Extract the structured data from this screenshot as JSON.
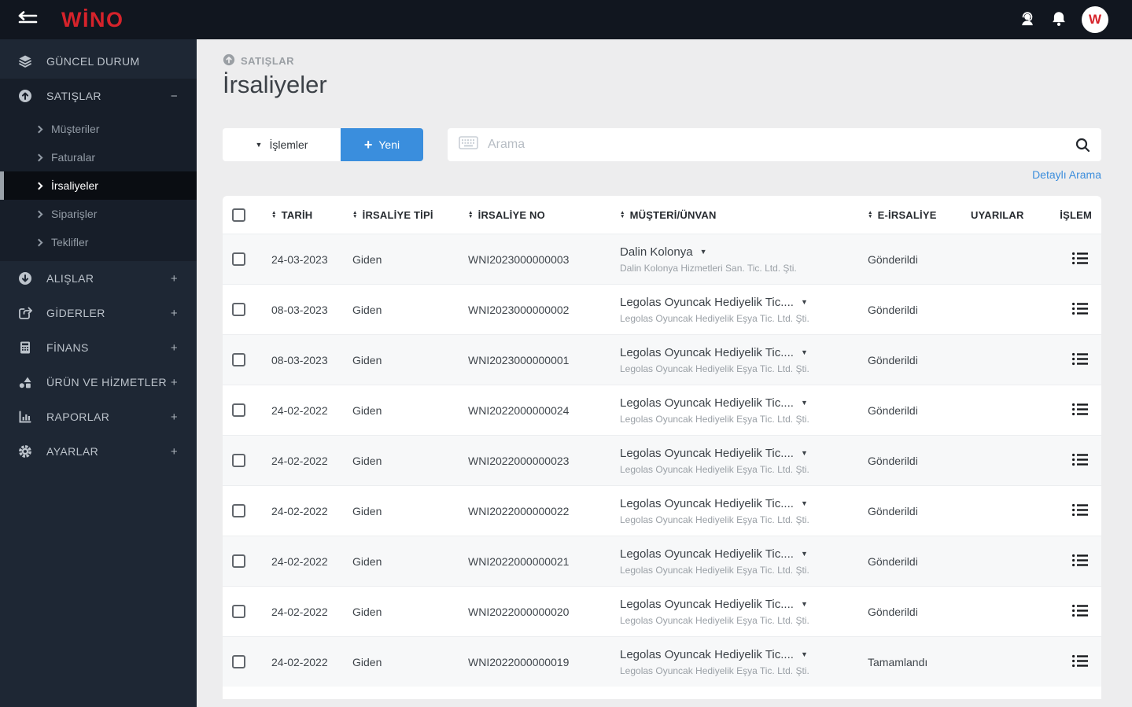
{
  "topbar": {
    "logo": "WİNO",
    "avatar_initial": "W"
  },
  "sidebar": {
    "items": [
      {
        "label": "GÜNCEL DURUM",
        "icon": "layers-icon"
      },
      {
        "label": "SATIŞLAR",
        "icon": "arrow-up-circle-icon",
        "toggle": "−",
        "children": [
          {
            "label": "Müşteriler"
          },
          {
            "label": "Faturalar"
          },
          {
            "label": "İrsaliyeler",
            "active": true
          },
          {
            "label": "Siparişler"
          },
          {
            "label": "Teklifler"
          }
        ]
      },
      {
        "label": "ALIŞLAR",
        "icon": "arrow-down-circle-icon",
        "toggle": "+"
      },
      {
        "label": "GİDERLER",
        "icon": "share-icon",
        "toggle": "+"
      },
      {
        "label": "FİNANS",
        "icon": "calculator-icon",
        "toggle": "+"
      },
      {
        "label": "ÜRÜN VE HİZMETLER",
        "icon": "shapes-icon",
        "toggle": "+"
      },
      {
        "label": "RAPORLAR",
        "icon": "bar-chart-icon",
        "toggle": "+"
      },
      {
        "label": "AYARLAR",
        "icon": "gear-icon",
        "toggle": "+"
      }
    ]
  },
  "page": {
    "breadcrumb": "SATIŞLAR",
    "title": "İrsaliyeler"
  },
  "toolbar": {
    "actions_label": "İşlemler",
    "new_label": "Yeni",
    "new_plus": "+",
    "search_placeholder": "Arama",
    "detailed_search_label": "Detaylı Arama"
  },
  "table": {
    "columns": [
      {
        "label": "TARİH",
        "sortable": true
      },
      {
        "label": "İRSALİYE TİPİ",
        "sortable": true
      },
      {
        "label": "İRSALİYE NO",
        "sortable": true
      },
      {
        "label": "MÜŞTERİ/ÜNVAN",
        "sortable": true
      },
      {
        "label": "E-İRSALİYE",
        "sortable": true
      },
      {
        "label": "UYARILAR",
        "sortable": false
      },
      {
        "label": "İŞLEM",
        "sortable": false
      }
    ],
    "rows": [
      {
        "date": "24-03-2023",
        "type": "Giden",
        "no": "WNI2023000000003",
        "customer": "Dalin Kolonya",
        "customer_sub": "Dalin Kolonya Hizmetleri San. Tic. Ltd. Şti.",
        "e_irsaliye": "Gönderildi",
        "uyarilar": ""
      },
      {
        "date": "08-03-2023",
        "type": "Giden",
        "no": "WNI2023000000002",
        "customer": "Legolas Oyuncak Hediyelik Tic....",
        "customer_sub": "Legolas Oyuncak Hediyelik Eşya Tic. Ltd. Şti.",
        "e_irsaliye": "Gönderildi",
        "uyarilar": ""
      },
      {
        "date": "08-03-2023",
        "type": "Giden",
        "no": "WNI2023000000001",
        "customer": "Legolas Oyuncak Hediyelik Tic....",
        "customer_sub": "Legolas Oyuncak Hediyelik Eşya Tic. Ltd. Şti.",
        "e_irsaliye": "Gönderildi",
        "uyarilar": ""
      },
      {
        "date": "24-02-2022",
        "type": "Giden",
        "no": "WNI2022000000024",
        "customer": "Legolas Oyuncak Hediyelik Tic....",
        "customer_sub": "Legolas Oyuncak Hediyelik Eşya Tic. Ltd. Şti.",
        "e_irsaliye": "Gönderildi",
        "uyarilar": ""
      },
      {
        "date": "24-02-2022",
        "type": "Giden",
        "no": "WNI2022000000023",
        "customer": "Legolas Oyuncak Hediyelik Tic....",
        "customer_sub": "Legolas Oyuncak Hediyelik Eşya Tic. Ltd. Şti.",
        "e_irsaliye": "Gönderildi",
        "uyarilar": ""
      },
      {
        "date": "24-02-2022",
        "type": "Giden",
        "no": "WNI2022000000022",
        "customer": "Legolas Oyuncak Hediyelik Tic....",
        "customer_sub": "Legolas Oyuncak Hediyelik Eşya Tic. Ltd. Şti.",
        "e_irsaliye": "Gönderildi",
        "uyarilar": ""
      },
      {
        "date": "24-02-2022",
        "type": "Giden",
        "no": "WNI2022000000021",
        "customer": "Legolas Oyuncak Hediyelik Tic....",
        "customer_sub": "Legolas Oyuncak Hediyelik Eşya Tic. Ltd. Şti.",
        "e_irsaliye": "Gönderildi",
        "uyarilar": ""
      },
      {
        "date": "24-02-2022",
        "type": "Giden",
        "no": "WNI2022000000020",
        "customer": "Legolas Oyuncak Hediyelik Tic....",
        "customer_sub": "Legolas Oyuncak Hediyelik Eşya Tic. Ltd. Şti.",
        "e_irsaliye": "Gönderildi",
        "uyarilar": ""
      },
      {
        "date": "24-02-2022",
        "type": "Giden",
        "no": "WNI2022000000019",
        "customer": "Legolas Oyuncak Hediyelik Tic....",
        "customer_sub": "Legolas Oyuncak Hediyelik Eşya Tic. Ltd. Şti.",
        "e_irsaliye": "Tamamlandı",
        "uyarilar": ""
      }
    ]
  },
  "colors": {
    "brand_red": "#d6232b",
    "accent_blue": "#3a8edd",
    "link_blue": "#3d8edc",
    "topbar_bg": "#11161f",
    "sidebar_bg": "#1e2734",
    "sidebar_group_bg": "#171e29",
    "active_item_bg": "#0a0d12",
    "content_bg": "#ededee",
    "row_alt_bg": "#f7f8f9"
  }
}
